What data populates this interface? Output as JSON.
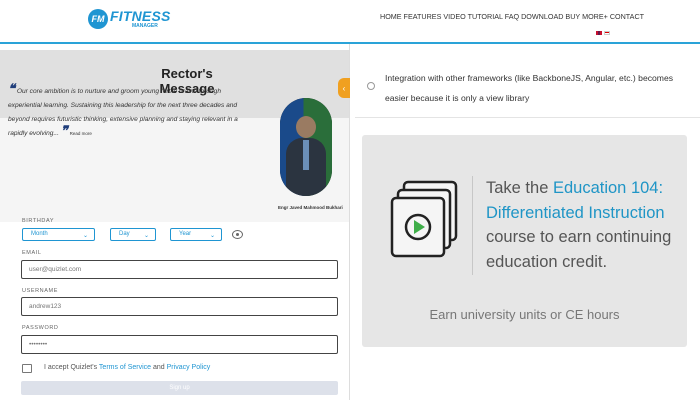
{
  "header": {
    "logo_badge": "FM",
    "logo_main": "FITNESS",
    "logo_sub": "MANAGER",
    "nav_text": "HOME FEATURES VIDEO TUTORIAL FAQ DOWNLOAD BUY MORE+ CONTACT",
    "flags": [
      "uk-flag-icon",
      "fr-flag-icon"
    ],
    "accent_color": "#1f95d2"
  },
  "rector": {
    "title": "Rector's Message",
    "quote": "Our core ambition is to nurture and groom young fertile brains through experiential learning. Sustaining this leadership for the next three decades and beyond requires futuristic thinking, extensive planning and staying relevant in a rapidly evolving...",
    "read_more": "Read more",
    "caption": "Engr Javed Mahmood Bukhari",
    "arrow": "‹"
  },
  "form": {
    "birthday_label": "BIRTHDAY",
    "month": "Month",
    "day": "Day",
    "year": "Year",
    "email_label": "EMAIL",
    "email_placeholder": "user@quizlet.com",
    "username_label": "USERNAME",
    "username_placeholder": "andrew123",
    "password_label": "PASSWORD",
    "password_placeholder": "••••••••",
    "terms_prefix": "I accept Quizlet's",
    "terms_link": "Terms of Service",
    "terms_and": "and",
    "privacy_link": "Privacy Policy",
    "signup": "Sign up"
  },
  "right": {
    "integration": "Integration with other frameworks (like BackboneJS, Angular, etc.) becomes easier because it is only a view library",
    "course_pre": "Take the",
    "course_name": "Education 104: Differentiated Instruction",
    "course_post": "course to earn continuing education credit.",
    "credit": "Earn university units or CE hours",
    "highlight_color": "#1f95c6"
  }
}
